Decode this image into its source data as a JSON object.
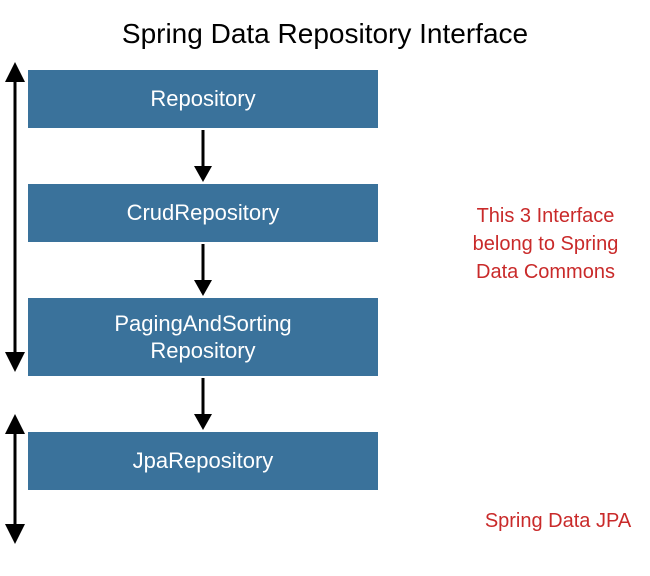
{
  "title": "Spring Data Repository Interface",
  "boxes": {
    "repository": "Repository",
    "crud": "CrudRepository",
    "paging_line1": "PagingAndSorting",
    "paging_line2": "Repository",
    "jpa": "JpaRepository"
  },
  "annotations": {
    "commons_line1": "This 3 Interface",
    "commons_line2": "belong to Spring",
    "commons_line3": "Data Commons",
    "jpa": "Spring Data JPA"
  },
  "colors": {
    "box_bg": "#3a729b",
    "box_text": "#ffffff",
    "annotation_text": "#c92a2a"
  }
}
